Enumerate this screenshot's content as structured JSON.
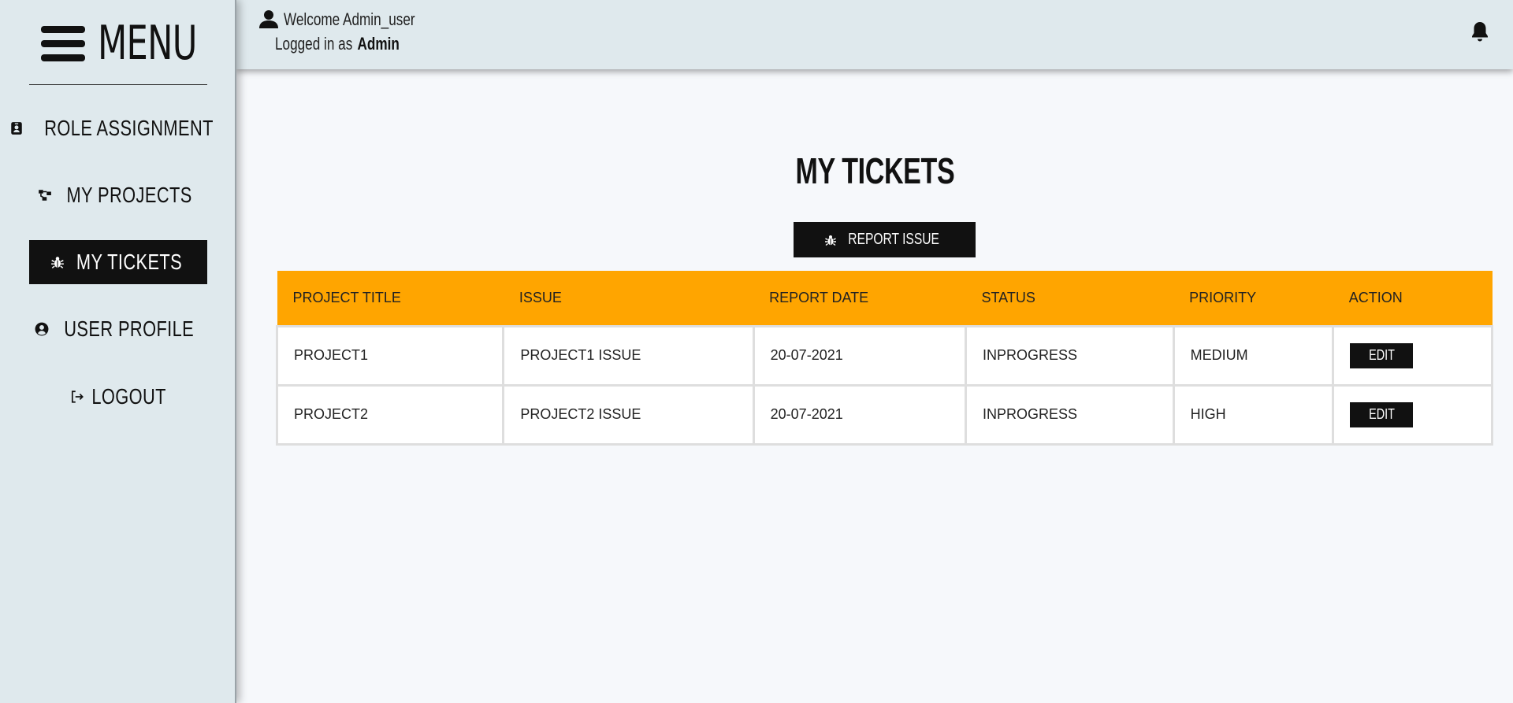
{
  "sidebar": {
    "menu_title": "MENU",
    "items": [
      {
        "label": "ROLE ASSIGNMENT",
        "icon": "id-badge-icon",
        "active": false
      },
      {
        "label": "MY PROJECTS",
        "icon": "project-diagram-icon",
        "active": false
      },
      {
        "label": "MY TICKETS",
        "icon": "bug-icon",
        "active": true
      },
      {
        "label": "USER PROFILE",
        "icon": "user-circle-icon",
        "active": false
      },
      {
        "label": "LOGOUT",
        "icon": "logout-icon",
        "active": false
      }
    ]
  },
  "header": {
    "welcome": "Welcome Admin_user",
    "logged_in_prefix": "Logged in as",
    "role": "Admin",
    "user_icon": "user-icon",
    "bell_icon": "bell-icon"
  },
  "main": {
    "title": "MY TICKETS",
    "report_button": {
      "label": "REPORT ISSUE",
      "icon": "bug-icon"
    },
    "table": {
      "headers": [
        "PROJECT TITLE",
        "ISSUE",
        "REPORT DATE",
        "STATUS",
        "PRIORITY",
        "ACTION"
      ],
      "rows": [
        {
          "project": "PROJECT1",
          "issue": "PROJECT1 ISSUE",
          "date": "20-07-2021",
          "status": "INPROGRESS",
          "priority": "MEDIUM",
          "action": "EDIT"
        },
        {
          "project": "PROJECT2",
          "issue": "PROJECT2 ISSUE",
          "date": "20-07-2021",
          "status": "INPROGRESS",
          "priority": "HIGH",
          "action": "EDIT"
        }
      ]
    }
  },
  "colors": {
    "sidebar_bg": "#dfe9ed",
    "header_bg": "#dfe9ed",
    "page_bg": "#f6f8fb",
    "table_header_bg": "#ffa500",
    "active_nav_bg": "#111111",
    "button_bg": "#111111"
  }
}
